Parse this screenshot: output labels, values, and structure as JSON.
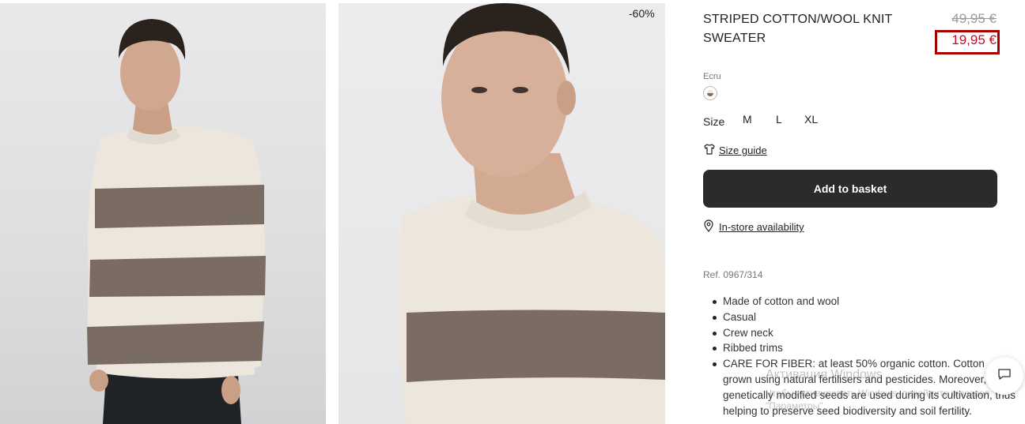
{
  "product": {
    "discount_badge": "-60%",
    "title": "STRIPED COTTON/WOOL KNIT SWEATER",
    "old_price": "49,95 €",
    "new_price": "19,95 €",
    "price_color": "#c0102a",
    "highlight_color": "#a40000"
  },
  "color": {
    "label": "Ecru",
    "swatch_icon": "ecru-swatch"
  },
  "sizes": {
    "label": "Size",
    "options": [
      "M",
      "L",
      "XL"
    ]
  },
  "size_guide": {
    "label": "Size guide",
    "icon": "tshirt-icon"
  },
  "basket_button": {
    "label": "Add to basket",
    "color": "#2b2b2b"
  },
  "store_availability": {
    "label": "In-store availability",
    "icon": "location-pin-icon"
  },
  "reference": "Ref. 0967/314",
  "features": [
    "Made of cotton and wool",
    "Casual",
    "Crew neck",
    "Ribbed trims",
    "CARE FOR FIBER: at least 50% organic cotton. Cotton grown using natural fertilisers and pesticides. Moreover, no genetically modified seeds are used during its cultivation, thus helping to preserve seed biodiversity and soil fertility."
  ],
  "os_watermark": {
    "title": "Активация Windows",
    "subtitle": "Чтобы активировать Windows, перейдите в раздел \"Параметры\"."
  },
  "chat": {
    "icon": "chat-bubble-icon"
  }
}
